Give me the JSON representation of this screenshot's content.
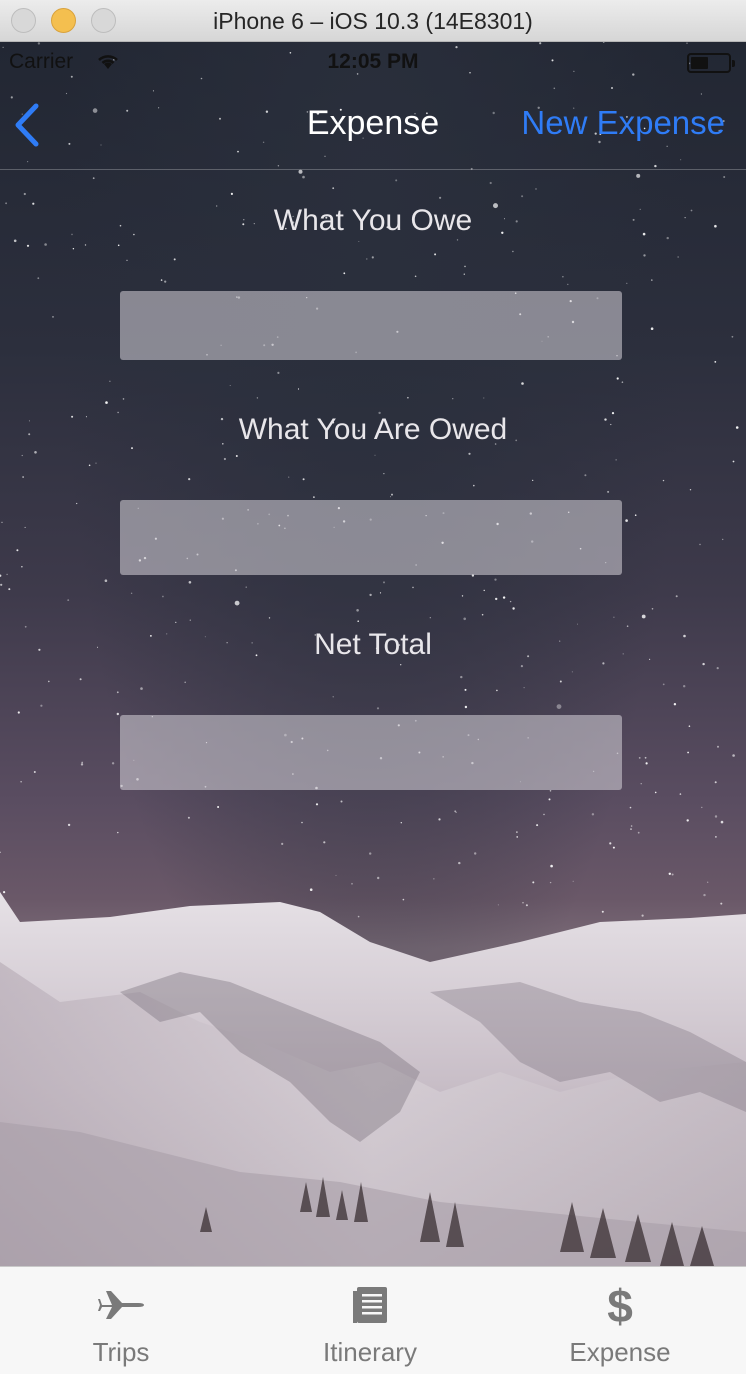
{
  "window": {
    "title": "iPhone 6 – iOS 10.3 (14E8301)"
  },
  "status_bar": {
    "carrier": "Carrier",
    "time": "12:05 PM"
  },
  "nav": {
    "title": "Expense",
    "right_button": "New Expense",
    "back_icon": "chevron-left-icon"
  },
  "form": {
    "owe_label": "What You Owe",
    "owe_value": "",
    "owed_label": "What You Are Owed",
    "owed_value": "",
    "net_label": "Net Total",
    "net_value": ""
  },
  "tabs": [
    {
      "label": "Trips",
      "icon": "airplane-icon"
    },
    {
      "label": "Itinerary",
      "icon": "document-icon"
    },
    {
      "label": "Expense",
      "icon": "dollar-icon"
    }
  ],
  "colors": {
    "accent": "#2f7cf6",
    "tab_inactive": "#7a7a7a",
    "tab_bar": "#f7f7f7"
  }
}
